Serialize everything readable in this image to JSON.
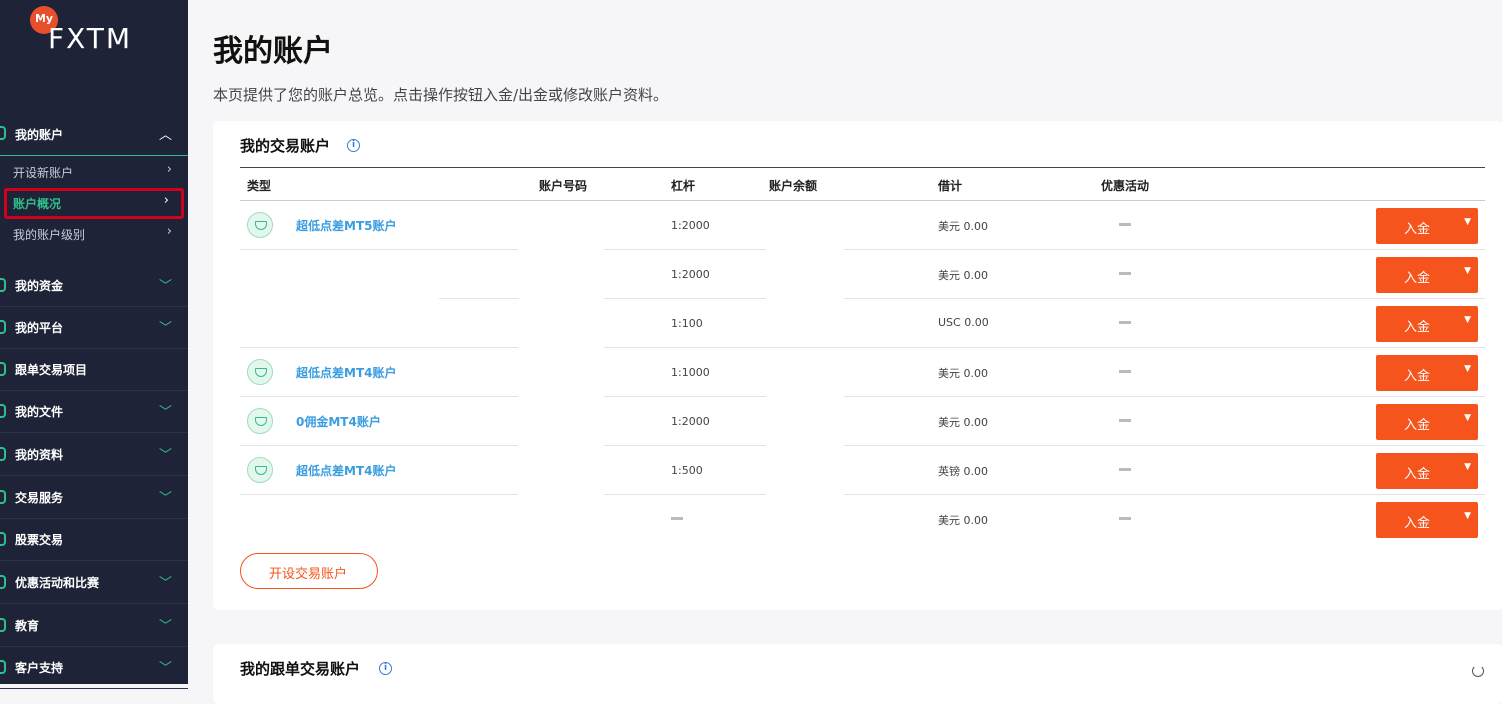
{
  "logo": {
    "badge": "My",
    "brand": "FXTM"
  },
  "sidebar": {
    "top_section": "我的账户",
    "sub_items": [
      {
        "label": "开设新账户"
      },
      {
        "label": "账户概况"
      },
      {
        "label": "我的账户级别"
      }
    ],
    "items": [
      {
        "label": "我的资金"
      },
      {
        "label": "我的平台"
      },
      {
        "label": "跟单交易项目"
      },
      {
        "label": "我的文件"
      },
      {
        "label": "我的资料"
      },
      {
        "label": "交易服务"
      },
      {
        "label": "股票交易"
      },
      {
        "label": "优惠活动和比赛"
      },
      {
        "label": "教育"
      },
      {
        "label": "客户支持"
      }
    ]
  },
  "page": {
    "title": "我的账户",
    "description": "本页提供了您的账户总览。点击操作按钮入金/出金或修改账户资料。"
  },
  "trading_accounts": {
    "title": "我的交易账户",
    "info_icon": "i",
    "columns": [
      "类型",
      "账户号码",
      "杠杆",
      "账户余额",
      "借计",
      "优惠活动"
    ],
    "rows": [
      {
        "name": "超低点差MT5账户",
        "leverage": "1:2000",
        "credit": "美元 0.00",
        "deposit": "入金"
      },
      {
        "name": "",
        "leverage": "1:2000",
        "credit": "美元 0.00",
        "deposit": "入金"
      },
      {
        "name": "",
        "leverage": "1:100",
        "credit": "USC 0.00",
        "deposit": "入金"
      },
      {
        "name": "超低点差MT4账户",
        "leverage": "1:1000",
        "credit": "美元 0.00",
        "deposit": "入金"
      },
      {
        "name": "0佣金MT4账户",
        "leverage": "1:2000",
        "credit": "美元 0.00",
        "deposit": "入金"
      },
      {
        "name": "超低点差MT4账户",
        "leverage": "1:500",
        "credit": "英镑 0.00",
        "deposit": "入金"
      },
      {
        "name": "",
        "leverage": "",
        "credit": "美元 0.00",
        "deposit": "入金"
      }
    ],
    "open_account_label": "开设交易账户"
  },
  "copy_accounts": {
    "title": "我的跟单交易账户",
    "info_icon": "i"
  },
  "colors": {
    "sidebar_bg": "#1f2338",
    "accent_green": "#2fbf8a",
    "deposit_orange": "#f5541d",
    "link_blue": "#3a9de0",
    "highlight_red": "#d0021b"
  }
}
